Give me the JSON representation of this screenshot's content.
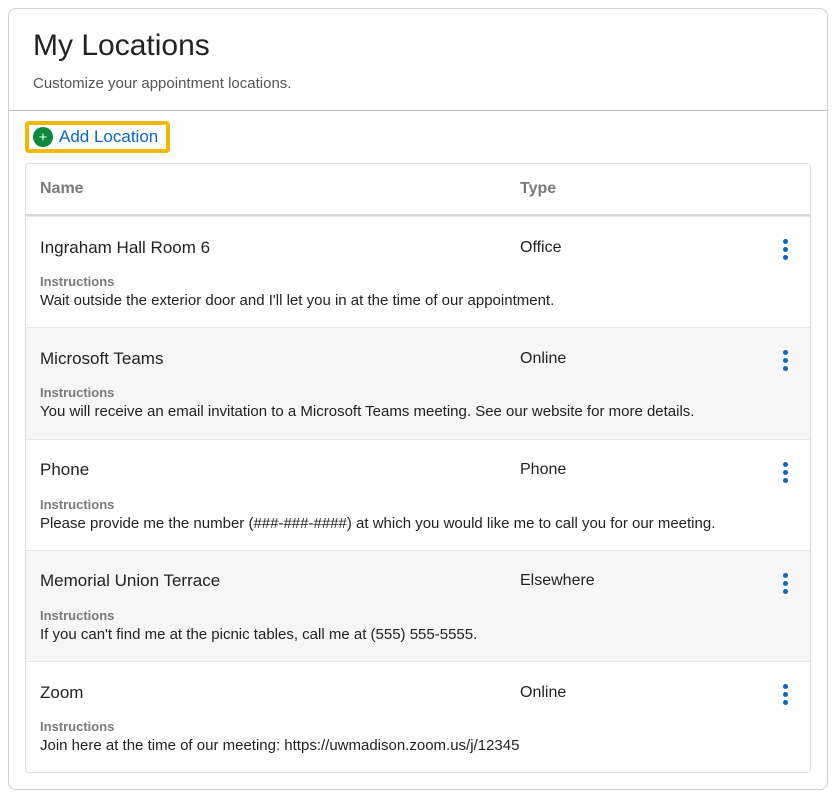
{
  "header": {
    "title": "My Locations",
    "subtitle": "Customize your appointment locations."
  },
  "toolbar": {
    "add_location_label": "Add Location"
  },
  "table": {
    "columns": {
      "name": "Name",
      "type": "Type"
    },
    "instructions_label": "Instructions",
    "rows": [
      {
        "name": "Ingraham Hall Room 6",
        "type": "Office",
        "instructions": "Wait outside the exterior door and I'll let you in at the time of our appointment."
      },
      {
        "name": "Microsoft Teams",
        "type": "Online",
        "instructions": "You will receive an email invitation to a Microsoft Teams meeting. See our website for more details."
      },
      {
        "name": "Phone",
        "type": "Phone",
        "instructions": "Please provide me the number (###-###-####) at which you would like me to call you for our meeting."
      },
      {
        "name": "Memorial Union Terrace",
        "type": "Elsewhere",
        "instructions": "If you can't find me at the picnic tables, call me at (555) 555-5555."
      },
      {
        "name": "Zoom",
        "type": "Online",
        "instructions": "Join here at the time of our meeting: https://uwmadison.zoom.us/j/12345"
      }
    ]
  }
}
